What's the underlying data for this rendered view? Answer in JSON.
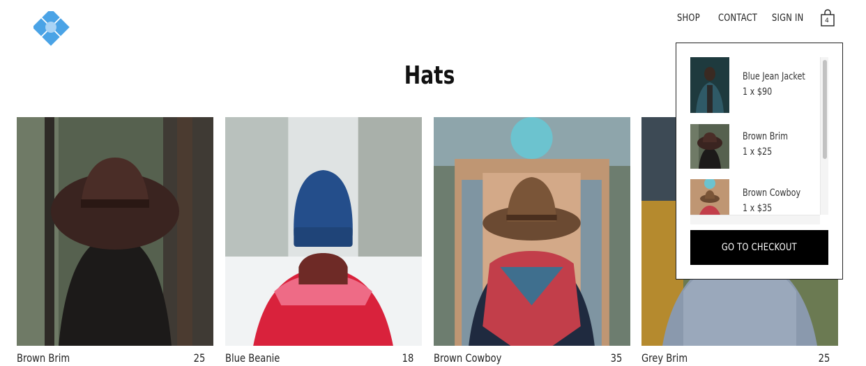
{
  "nav": {
    "shop": "SHOP",
    "contact": "CONTACT",
    "sign_in": "SIGN IN",
    "cart_count": "4"
  },
  "page": {
    "title": "Hats"
  },
  "products": [
    {
      "name": "Brown Brim",
      "price": "25",
      "icon": "brown-brim-photo"
    },
    {
      "name": "Blue Beanie",
      "price": "18",
      "icon": "blue-beanie-photo"
    },
    {
      "name": "Brown Cowboy",
      "price": "35",
      "icon": "brown-cowboy-photo"
    },
    {
      "name": "Grey Brim",
      "price": "25",
      "icon": "grey-brim-photo"
    }
  ],
  "cart": {
    "items": [
      {
        "name": "Blue Jean Jacket",
        "qty_price": "1 x $90"
      },
      {
        "name": "Brown Brim",
        "qty_price": "1 x $25"
      },
      {
        "name": "Brown Cowboy",
        "qty_price": "1 x $35"
      }
    ],
    "checkout_label": "GO TO CHECKOUT"
  },
  "colors": {
    "logo_blue": "#4aa3e6",
    "logo_light": "#a9d3f5",
    "checkout_bg": "#000000"
  }
}
